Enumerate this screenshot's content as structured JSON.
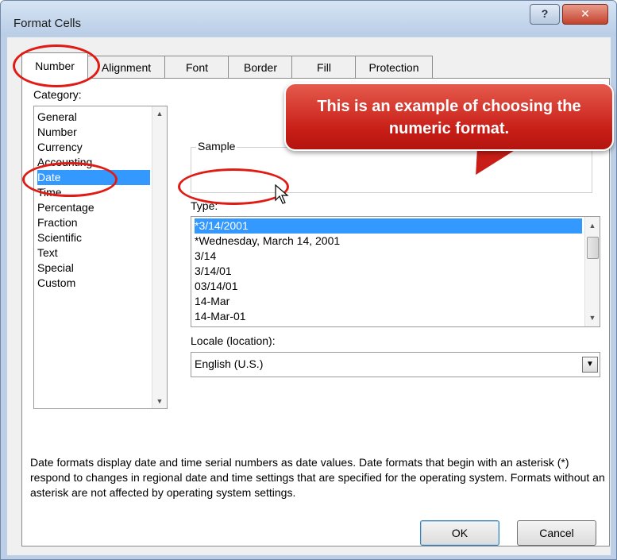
{
  "window": {
    "title": "Format Cells",
    "help_label": "?",
    "close_label": "✕"
  },
  "tabs": [
    {
      "label": "Number",
      "active": true
    },
    {
      "label": "Alignment"
    },
    {
      "label": "Font"
    },
    {
      "label": "Border"
    },
    {
      "label": "Fill"
    },
    {
      "label": "Protection"
    }
  ],
  "category": {
    "label": "Category:",
    "items": [
      "General",
      "Number",
      "Currency",
      "Accounting",
      "Date",
      "Time",
      "Percentage",
      "Fraction",
      "Scientific",
      "Text",
      "Special",
      "Custom"
    ],
    "selected": "Date"
  },
  "sample": {
    "label": "Sample"
  },
  "type": {
    "label": "Type:",
    "items": [
      "*3/14/2001",
      "*Wednesday, March 14, 2001",
      "3/14",
      "3/14/01",
      "03/14/01",
      "14-Mar",
      "14-Mar-01"
    ],
    "selected": "*3/14/2001"
  },
  "locale": {
    "label": "Locale (location):",
    "value": "English (U.S.)"
  },
  "description": "Date formats display date and time serial numbers as date values.  Date formats that begin with an asterisk (*) respond to changes in regional date and time settings that are specified for the operating system. Formats without an asterisk are not affected by operating system settings.",
  "buttons": {
    "ok": "OK",
    "cancel": "Cancel"
  },
  "callout": {
    "text": "This is an example of choosing the numeric format."
  },
  "colors": {
    "accent_red": "#c81e17",
    "selection_blue": "#3399ff"
  }
}
